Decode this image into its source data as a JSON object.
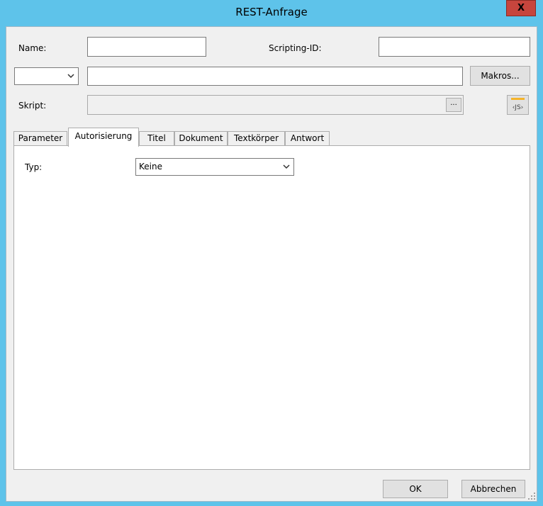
{
  "window": {
    "title": "REST-Anfrage",
    "close_label": "X"
  },
  "form": {
    "name_label": "Name:",
    "name_value": "",
    "scripting_id_label": "Scripting-ID:",
    "scripting_id_value": "",
    "method_value": "",
    "url_value": "",
    "makros_label": "Makros...",
    "script_label": "Skript:",
    "script_value": "",
    "ellipsis_label": "...",
    "js_icon": "js-script-icon"
  },
  "tabs": [
    {
      "label": "Parameter",
      "active": false
    },
    {
      "label": "Autorisierung",
      "active": true
    },
    {
      "label": "Titel",
      "active": false
    },
    {
      "label": "Dokument",
      "active": false
    },
    {
      "label": "Textkörper",
      "active": false
    },
    {
      "label": "Antwort",
      "active": false
    }
  ],
  "auth": {
    "type_label": "Typ:",
    "type_value": "Keine"
  },
  "footer": {
    "ok_label": "OK",
    "cancel_label": "Abbrechen"
  },
  "colors": {
    "titlebar": "#5ec3ea",
    "close_button": "#c7453d",
    "client_bg": "#f0f0f0"
  }
}
